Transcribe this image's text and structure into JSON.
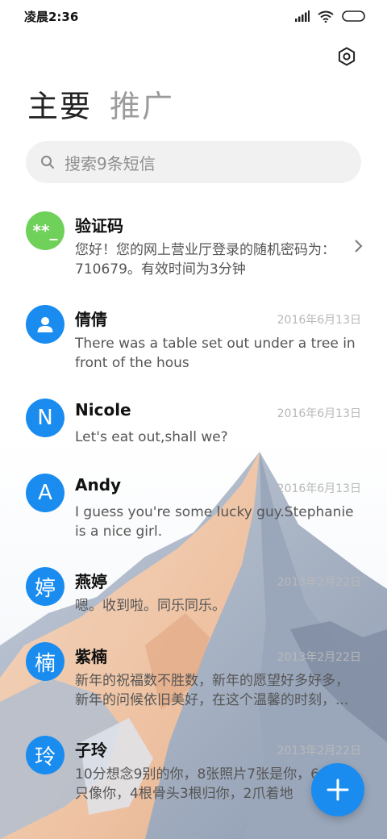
{
  "status_bar": {
    "time": "凌晨2:36"
  },
  "tabs": [
    {
      "label": "主要"
    },
    {
      "label": "推广"
    }
  ],
  "search": {
    "placeholder": "搜索9条短信"
  },
  "conversations": [
    {
      "name": "验证码",
      "date": "",
      "preview": "您好！您的网上营业厅登录的随机密码为：710679。有效时间为3分钟",
      "avatar_text": "**_",
      "avatar_color": "#6fd05a",
      "has_chevron": true
    },
    {
      "name": "倩倩",
      "date": "2016年6月13日",
      "preview": "There was a table set out under a tree in front of the hous",
      "avatar_text": "",
      "avatar_color": "#1a8cf0",
      "avatar_icon": "person-icon"
    },
    {
      "name": "Nicole",
      "date": "2016年6月13日",
      "preview": "Let's eat out,shall we?",
      "avatar_text": "N",
      "avatar_color": "#1a8cf0"
    },
    {
      "name": "Andy",
      "date": "2016年6月13日",
      "preview": "I guess you're some lucky guy.Stephanie is a nice girl.",
      "avatar_text": "A",
      "avatar_color": "#1a8cf0"
    },
    {
      "name": "燕婷",
      "date": "2013年2月22日",
      "preview": "嗯。收到啦。同乐同乐。",
      "avatar_text": "婷",
      "avatar_color": "#1a8cf0"
    },
    {
      "name": "紫楠",
      "date": "2013年2月22日",
      "preview": "新年的祝福数不胜数，新年的愿望好多好多，新年的问候依旧美好，在这个温馨的时刻，...",
      "avatar_text": "楠",
      "avatar_color": "#1a8cf0"
    },
    {
      "name": "子玲",
      "date": "2013年2月22日",
      "preview": "10分想念9别的你，8张照片7张是你，6条狗5只像你，4根骨头3根归你，2爪着地",
      "avatar_text": "玲",
      "avatar_color": "#1a8cf0"
    }
  ],
  "colors": {
    "accent": "#1a8cf0",
    "code_avatar": "#6fd05a"
  },
  "icons": {
    "settings": "settings-icon",
    "search": "search-icon",
    "fab": "plus-icon",
    "chevron": "chevron-right-icon"
  }
}
